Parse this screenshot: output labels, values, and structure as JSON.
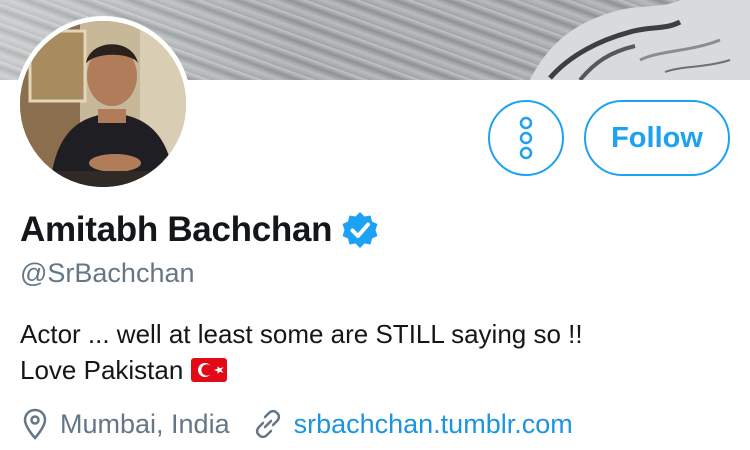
{
  "profile": {
    "display_name": "Amitabh Bachchan",
    "handle": "@SrBachchan",
    "bio_line1": "Actor ... well at least some are STILL saying so !!",
    "bio_line2": "Love Pakistan",
    "location": "Mumbai, India",
    "website": "srbachchan.tumblr.com",
    "verified": true,
    "flag_icon": "turkey-flag-icon"
  },
  "actions": {
    "follow_label": "Follow",
    "more_icon": "more-vertical-icon"
  },
  "colors": {
    "accent": "#1da1f2",
    "link": "#1b95e0",
    "secondary_text": "#657786",
    "primary_text": "#14171a",
    "flag_red": "#e30a17"
  }
}
